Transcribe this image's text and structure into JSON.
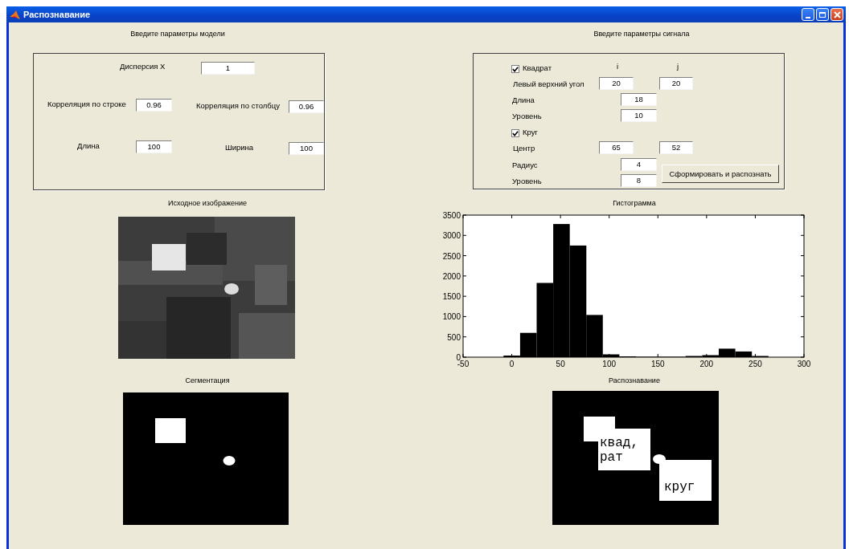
{
  "window": {
    "title": "Распознавание"
  },
  "model_panel": {
    "heading": "Введите параметры модели",
    "fields": [
      {
        "label": "Дисперсия X",
        "value": "1"
      },
      {
        "label": "Корреляция по строке",
        "value": "0.96"
      },
      {
        "label": "Корреляция по столбцу",
        "value": "0.96"
      },
      {
        "label": "Длина",
        "value": "100"
      },
      {
        "label": "Ширина",
        "value": "100"
      }
    ]
  },
  "signal_panel": {
    "heading": "Введите параметры сигнала",
    "column_labels": [
      "i",
      "j"
    ],
    "items": [
      {
        "kind": "checkbox",
        "label": "Квадрат",
        "checked": true
      },
      {
        "kind": "pair",
        "label": "Левый верхний угол",
        "values": [
          "20",
          "20"
        ]
      },
      {
        "kind": "single",
        "label": "Длина",
        "value": "18"
      },
      {
        "kind": "single",
        "label": "Уровень",
        "value": "10"
      },
      {
        "kind": "checkbox",
        "label": "Круг",
        "checked": true
      },
      {
        "kind": "pair",
        "label": "Центр",
        "values": [
          "65",
          "52"
        ]
      },
      {
        "kind": "single",
        "label": "Радиус",
        "value": "4"
      },
      {
        "kind": "single",
        "label": "Уровень",
        "value": "8"
      }
    ],
    "button": "Сформировать и распознать"
  },
  "source_image": {
    "title": "Исходное изображение",
    "kind": "picture"
  },
  "histogram": {
    "title": "Гистограмма",
    "chart_data": {
      "type": "bar",
      "x": [
        0,
        17,
        34,
        51,
        68,
        85,
        102,
        119,
        136,
        153,
        170,
        187,
        204,
        221,
        238,
        255
      ],
      "series": [
        {
          "color": "#000000",
          "values": [
            40,
            600,
            1830,
            3280,
            2750,
            1040,
            70,
            20,
            0,
            0,
            0,
            30,
            50,
            210,
            140,
            30
          ]
        }
      ],
      "xlim": [
        -50,
        300
      ],
      "ylim": [
        0,
        3500
      ],
      "xticks": [
        -50,
        0,
        50,
        100,
        150,
        200,
        250,
        300
      ],
      "yticks": [
        0,
        500,
        1000,
        1500,
        2000,
        2500,
        3000,
        3500
      ]
    }
  },
  "segmentation": {
    "title": "Сегментация"
  },
  "recognition": {
    "title": "Распознавание",
    "labels": [
      {
        "lines": [
          "квад,",
          "рат"
        ]
      },
      {
        "lines": [
          "круг"
        ]
      }
    ]
  }
}
